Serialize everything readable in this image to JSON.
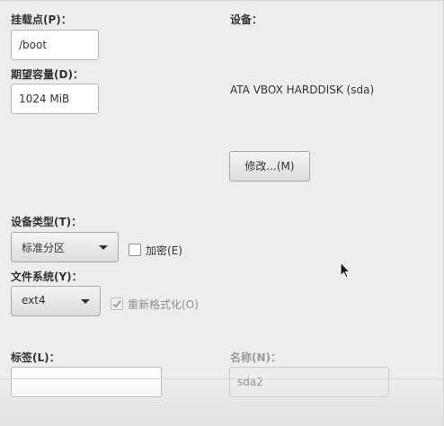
{
  "mount_point": {
    "label": "挂载点(P)：",
    "value": "/boot"
  },
  "desired_capacity": {
    "label": "期望容量(D)：",
    "value": "1024 MiB"
  },
  "device": {
    "label": "设备：",
    "value": "ATA VBOX HARDDISK (sda)",
    "modify_button": "修改...(M)"
  },
  "device_type": {
    "label": "设备类型(T)：",
    "selected": "标准分区",
    "encrypt_label": "加密(E)",
    "encrypt_checked": false
  },
  "file_system": {
    "label": "文件系统(Y)：",
    "selected": "ext4",
    "reformat_label": "重新格式化(O)",
    "reformat_checked": true
  },
  "tag": {
    "label": "标签(L)：",
    "value": ""
  },
  "name": {
    "label": "名称(N)：",
    "value": "sda2"
  }
}
